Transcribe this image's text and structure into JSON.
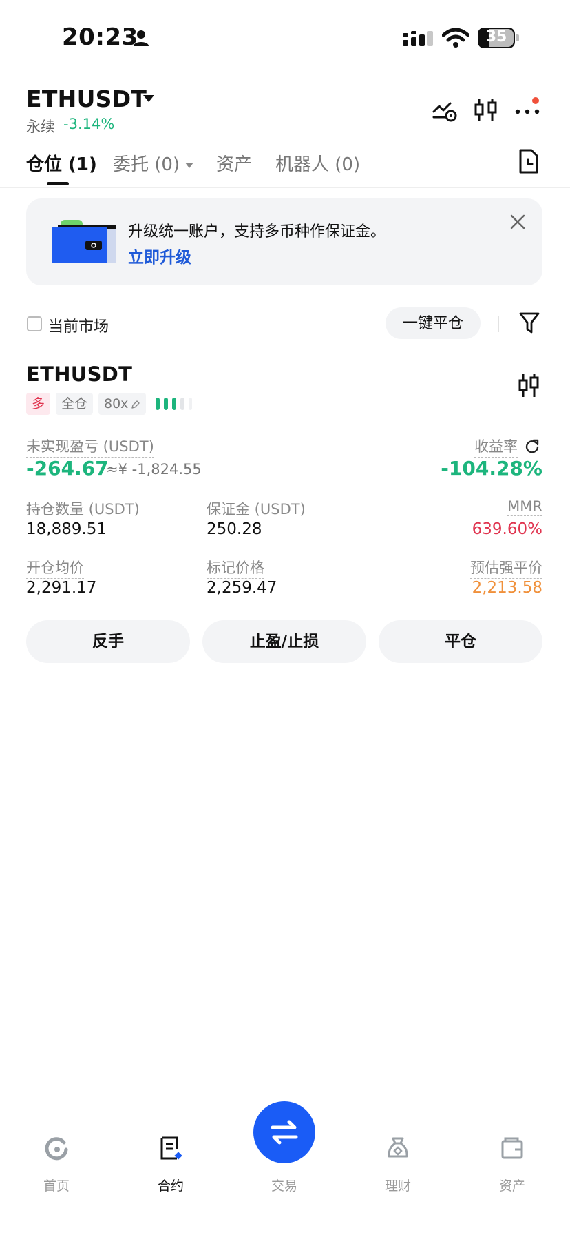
{
  "status_bar": {
    "time": "20:23",
    "battery": "35"
  },
  "header": {
    "pair": "ETHUSDT",
    "contract_type": "永续",
    "change": "-3.14%"
  },
  "tabs": [
    {
      "label": "仓位 (1)"
    },
    {
      "label": "委托 (0)"
    },
    {
      "label": "资产"
    },
    {
      "label": "机器人 (0)"
    }
  ],
  "banner": {
    "text": "升级统一账户，支持多币种作保证金。",
    "link": "立即升级"
  },
  "filter": {
    "current_market": "当前市场",
    "close_all": "一键平仓"
  },
  "position": {
    "symbol": "ETHUSDT",
    "side": "多",
    "margin_mode": "全仓",
    "leverage": "80x",
    "upnl_label": "未实现盈亏 (USDT)",
    "upnl": "-264.67",
    "upnl_cny": "≈¥ -1,824.55",
    "roi_label": "收益率",
    "roi": "-104.28%",
    "size_label": "持仓数量 (USDT)",
    "size": "18,889.51",
    "margin_label": "保证金 (USDT)",
    "margin": "250.28",
    "mmr_label": "MMR",
    "mmr": "639.60%",
    "entry_label": "开仓均价",
    "entry": "2,291.17",
    "mark_label": "标记价格",
    "mark": "2,259.47",
    "liq_label": "预估强平价",
    "liq": "2,213.58"
  },
  "actions": {
    "reverse": "反手",
    "tpsl": "止盈/止损",
    "close": "平仓"
  },
  "nav": {
    "home": "首页",
    "contract": "合约",
    "trade": "交易",
    "finance": "理财",
    "assets": "资产"
  },
  "colors": {
    "green": "#1db57d",
    "red": "#e0344f",
    "orange": "#f0903a",
    "blue": "#1a5cf6"
  }
}
